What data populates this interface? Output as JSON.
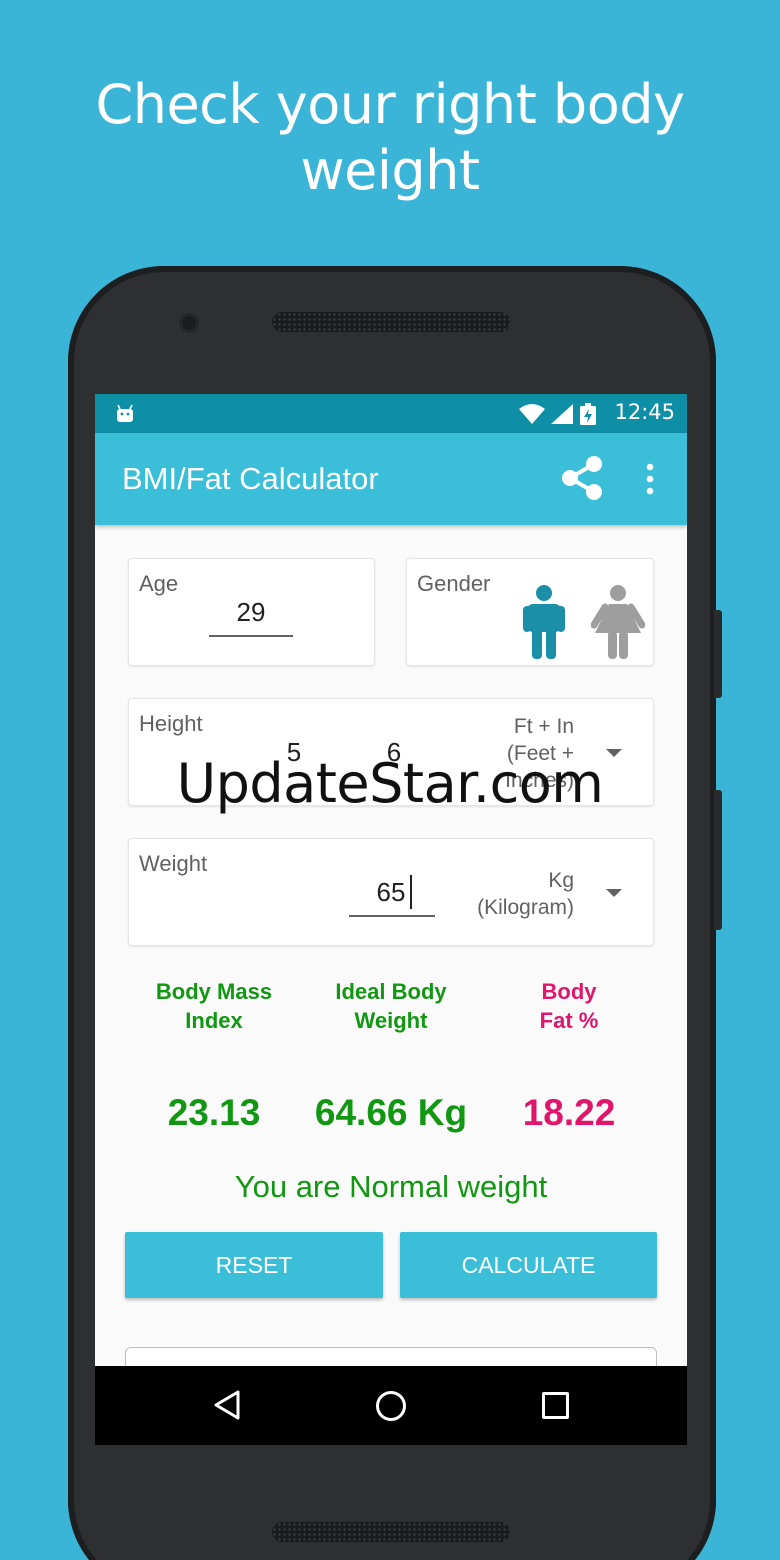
{
  "promo": {
    "headline_line1": "Check your right body",
    "headline_line2": "weight"
  },
  "statusbar": {
    "time": "12:45"
  },
  "appbar": {
    "title": "BMI/Fat Calculator"
  },
  "age": {
    "label": "Age",
    "value": "29"
  },
  "gender": {
    "label": "Gender",
    "selected": "male"
  },
  "height": {
    "label": "Height",
    "feet": "5",
    "inches": "6",
    "unit_line1": "Ft + In",
    "unit_line2": "(Feet +",
    "unit_line3": "Inches)"
  },
  "weight": {
    "label": "Weight",
    "value": "65",
    "unit_line1": "Kg",
    "unit_line2": "(Kilogram)"
  },
  "results": {
    "bmi_label_line1": "Body Mass",
    "bmi_label_line2": "Index",
    "ideal_label_line1": "Ideal Body",
    "ideal_label_line2": "Weight",
    "fat_label_line1": "Body",
    "fat_label_line2": "Fat %",
    "bmi_value": "23.13",
    "ideal_value": "64.66 Kg",
    "fat_value": "18.22",
    "status": "You are Normal weight"
  },
  "buttons": {
    "reset": "RESET",
    "calculate": "CALCULATE"
  },
  "watermark": "UpdateStar.com",
  "colors": {
    "background": "#3bb5d7",
    "accent": "#3bbed8",
    "statusbar": "#0e8fa6",
    "green": "#119711",
    "pink": "#e0156b",
    "male_icon": "#1b8ea8",
    "female_icon": "#9e9e9e"
  }
}
